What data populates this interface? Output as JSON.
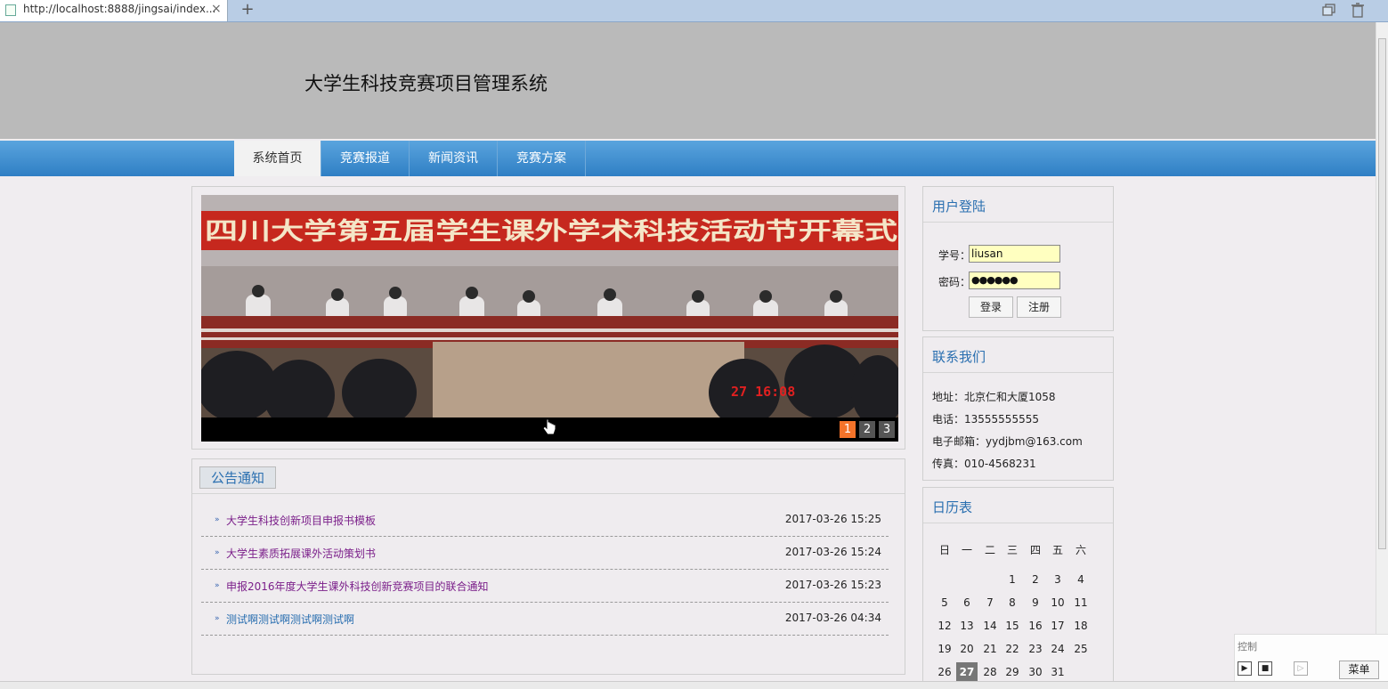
{
  "browser": {
    "url": "http://localhost:8888/jingsai/index...",
    "close_glyph": "×",
    "new_tab_glyph": "+"
  },
  "site": {
    "title": "大学生科技竞赛项目管理系统"
  },
  "nav": {
    "items": [
      {
        "label": "系统首页"
      },
      {
        "label": "竞赛报道"
      },
      {
        "label": "新闻资讯"
      },
      {
        "label": "竞赛方案"
      }
    ]
  },
  "slider": {
    "banner_text": "四川大学第五届学生课外学术科技活动节开幕式",
    "timestamp_text": "27 16:08",
    "pages": [
      "1",
      "2",
      "3"
    ],
    "active_page": "1"
  },
  "notice": {
    "title": "公告通知",
    "items": [
      {
        "title": "大学生科技创新项目申报书模板",
        "date": "2017-03-26 15:25",
        "color": "#7b1f8a"
      },
      {
        "title": "大学生素质拓展课外活动策划书",
        "date": "2017-03-26 15:24",
        "color": "#7b1f8a"
      },
      {
        "title": "申报2016年度大学生课外科技创新竞赛项目的联合通知",
        "date": "2017-03-26 15:23",
        "color": "#7b1f8a"
      },
      {
        "title": "测试啊测试啊测试啊测试啊",
        "date": "2017-03-26 04:34",
        "color": "#2a6fb0"
      }
    ]
  },
  "login": {
    "title": "用户登陆",
    "id_label": "学号：",
    "id_value": "liusan",
    "pwd_label": "密码：",
    "pwd_value": "●●●●●●",
    "login_button": "登录",
    "register_button": "注册"
  },
  "contact": {
    "title": "联系我们",
    "address": "地址：北京仁和大厦1058",
    "phone": "电话：13555555555",
    "email": "电子邮箱：yydjbm@163.com",
    "fax": "传真：010-4568231"
  },
  "calendar": {
    "title": "日历表",
    "weekdays": [
      "日",
      "一",
      "二",
      "三",
      "四",
      "五",
      "六"
    ],
    "weeks": [
      [
        "",
        "",
        "",
        "1",
        "2",
        "3",
        "4"
      ],
      [
        "5",
        "6",
        "7",
        "8",
        "9",
        "10",
        "11"
      ],
      [
        "12",
        "13",
        "14",
        "15",
        "16",
        "17",
        "18"
      ],
      [
        "19",
        "20",
        "21",
        "22",
        "23",
        "24",
        "25"
      ],
      [
        "26",
        "27",
        "28",
        "29",
        "30",
        "31",
        ""
      ]
    ],
    "today": "27"
  },
  "control": {
    "title": "控制",
    "menu_label": "菜单"
  }
}
